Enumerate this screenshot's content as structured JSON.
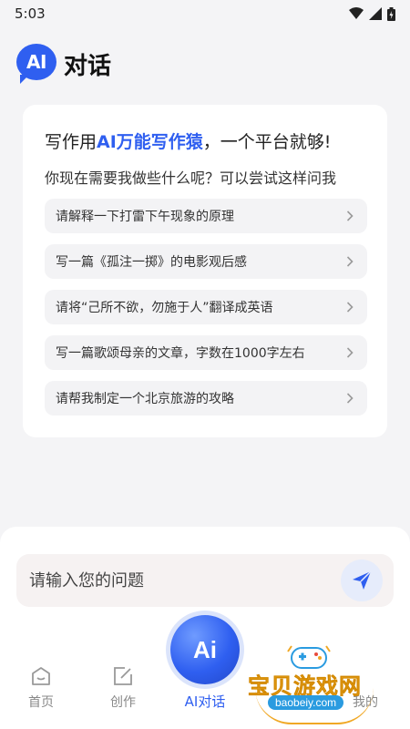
{
  "status_bar": {
    "time": "5:03",
    "icons": [
      "wifi-icon",
      "signal-icon",
      "battery-icon"
    ]
  },
  "header": {
    "logo_text": "AI",
    "title": "对话"
  },
  "card": {
    "headline_prefix": "写作用",
    "headline_brand": "AI万能写作猿",
    "headline_suffix": "，一个平台就够!",
    "subline": "你现在需要我做些什么呢？可以尝试这样问我",
    "suggestions": [
      {
        "text": "请解释一下打雷下午现象的原理"
      },
      {
        "text": "写一篇《孤注一掷》的电影观后感"
      },
      {
        "text": "请将“己所不欲，勿施于人”翻译成英语"
      },
      {
        "text": "写一篇歌颂母亲的文章，字数在1000字左右"
      },
      {
        "text": "请帮我制定一个北京旅游的攻略"
      }
    ]
  },
  "input": {
    "placeholder": "请输入您的问题",
    "value": ""
  },
  "tabbar": {
    "tabs": [
      {
        "label": "首页",
        "icon": "home-icon"
      },
      {
        "label": "创作",
        "icon": "edit-icon"
      },
      {
        "label": "AI对话",
        "icon_text": "Ai",
        "active": true
      },
      {
        "label": "我的",
        "icon": "user-icon"
      }
    ]
  },
  "watermark": {
    "text": "宝贝游戏网",
    "url": "baobeiy.com"
  },
  "colors": {
    "accent": "#2f5ff0",
    "card_bg": "#ffffff",
    "page_bg": "#f4f4f6",
    "watermark": "#f0a825"
  }
}
